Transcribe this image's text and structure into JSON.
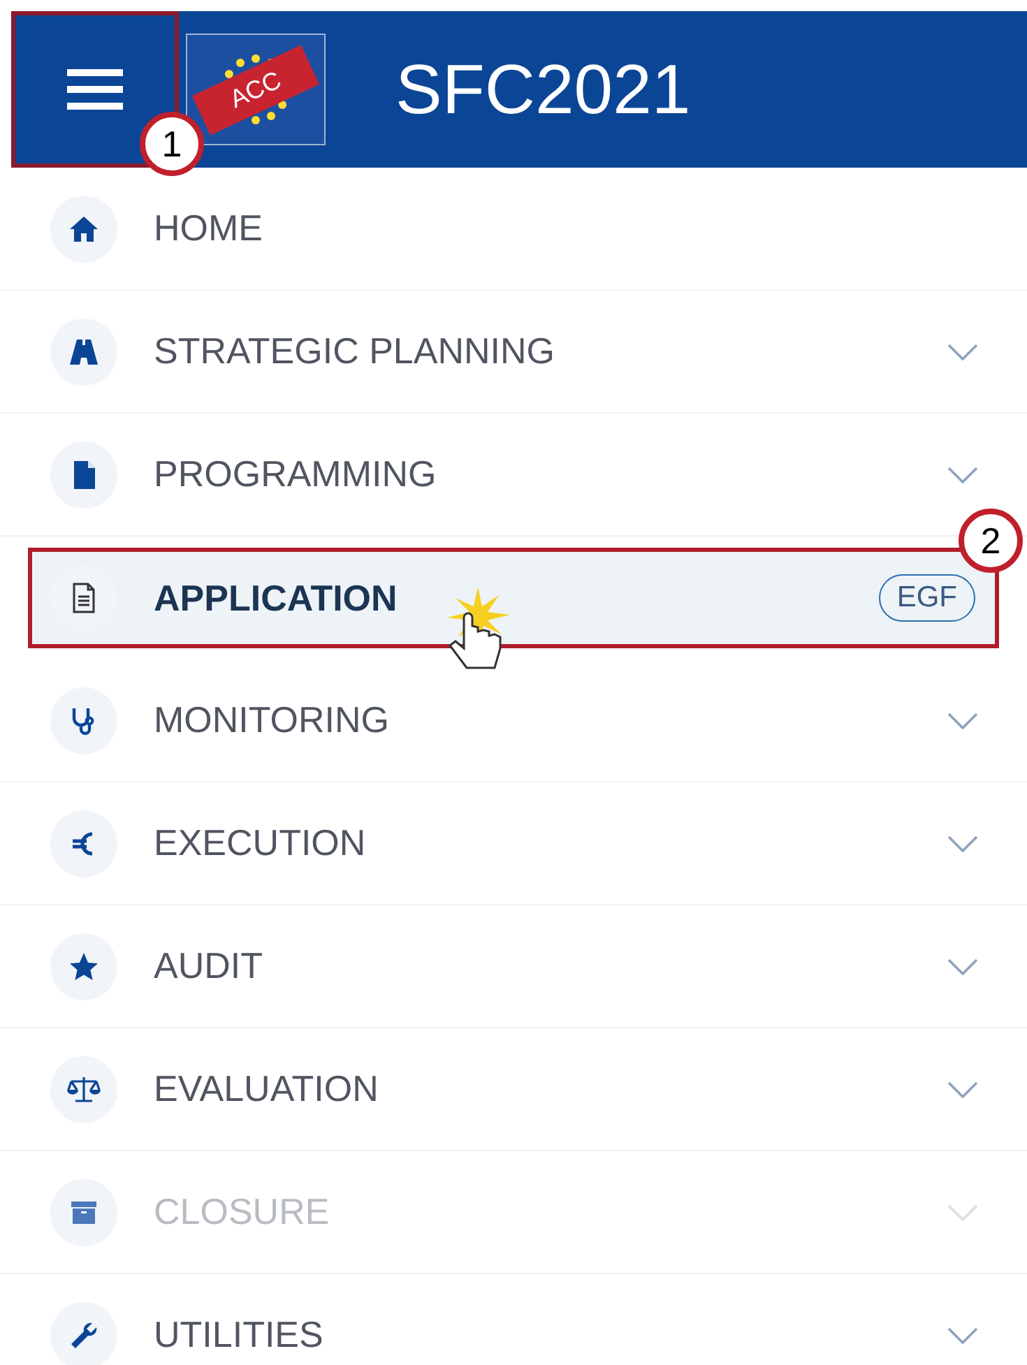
{
  "header": {
    "title": "SFC2021",
    "logo_ribbon": "ACC"
  },
  "menu": [
    {
      "label": "HOME",
      "expandable": false,
      "selected": false,
      "disabled": false
    },
    {
      "label": "STRATEGIC PLANNING",
      "expandable": true,
      "selected": false,
      "disabled": false
    },
    {
      "label": "PROGRAMMING",
      "expandable": true,
      "selected": false,
      "disabled": false
    },
    {
      "label": "APPLICATION",
      "expandable": false,
      "selected": true,
      "disabled": false,
      "badge": "EGF"
    },
    {
      "label": "MONITORING",
      "expandable": true,
      "selected": false,
      "disabled": false
    },
    {
      "label": "EXECUTION",
      "expandable": true,
      "selected": false,
      "disabled": false
    },
    {
      "label": "AUDIT",
      "expandable": true,
      "selected": false,
      "disabled": false
    },
    {
      "label": "EVALUATION",
      "expandable": true,
      "selected": false,
      "disabled": false
    },
    {
      "label": "CLOSURE",
      "expandable": true,
      "selected": false,
      "disabled": true
    },
    {
      "label": "UTILITIES",
      "expandable": true,
      "selected": false,
      "disabled": false
    }
  ],
  "callouts": [
    "1",
    "2"
  ]
}
